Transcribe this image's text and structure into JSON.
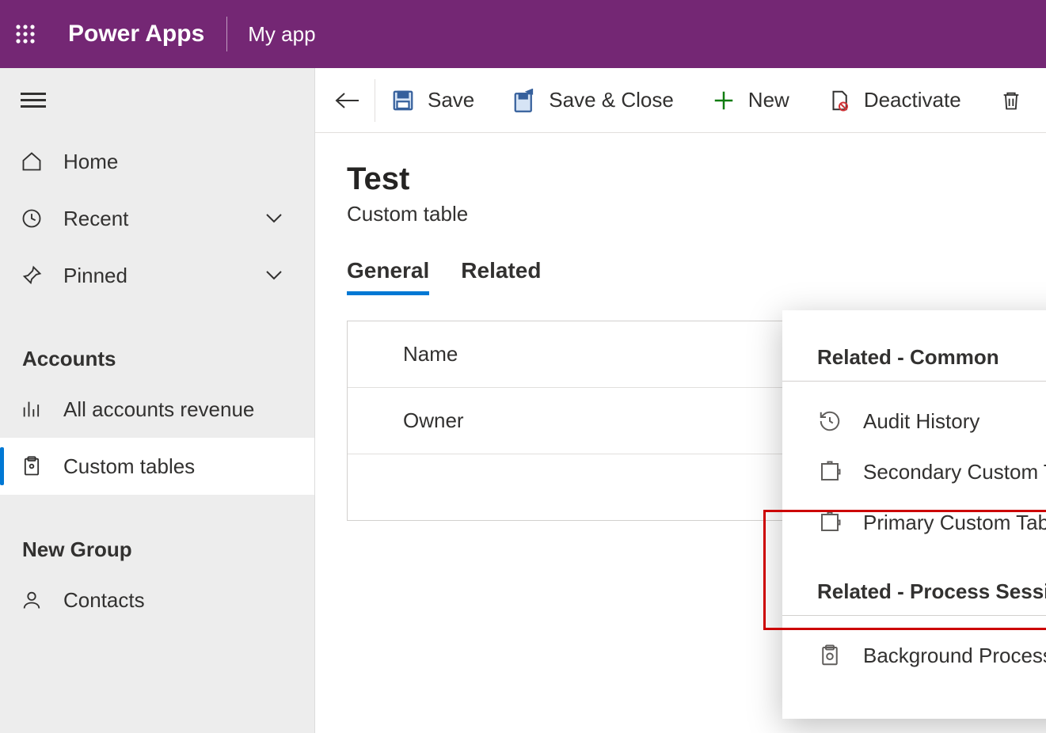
{
  "header": {
    "brand": "Power Apps",
    "appname": "My app"
  },
  "sidebar": {
    "items": [
      {
        "label": "Home"
      },
      {
        "label": "Recent"
      },
      {
        "label": "Pinned"
      }
    ],
    "group1_title": "Accounts",
    "group1_items": [
      {
        "label": "All accounts revenue"
      },
      {
        "label": "Custom tables"
      }
    ],
    "group2_title": "New Group",
    "group2_items": [
      {
        "label": "Contacts"
      }
    ]
  },
  "commands": {
    "save": "Save",
    "save_close": "Save & Close",
    "new": "New",
    "deactivate": "Deactivate"
  },
  "page": {
    "title": "Test",
    "subtitle": "Custom table"
  },
  "tabs": {
    "general": "General",
    "related": "Related"
  },
  "form": {
    "name_label": "Name",
    "owner_label": "Owner"
  },
  "related_popup": {
    "group1_title": "Related - Common",
    "group1_items": [
      "Audit History",
      "Secondary Custom Table Relationship",
      "Primary Custom Table Relationship"
    ],
    "group2_title": "Related - Process Sessions",
    "group2_items": [
      "Background Processes"
    ]
  }
}
